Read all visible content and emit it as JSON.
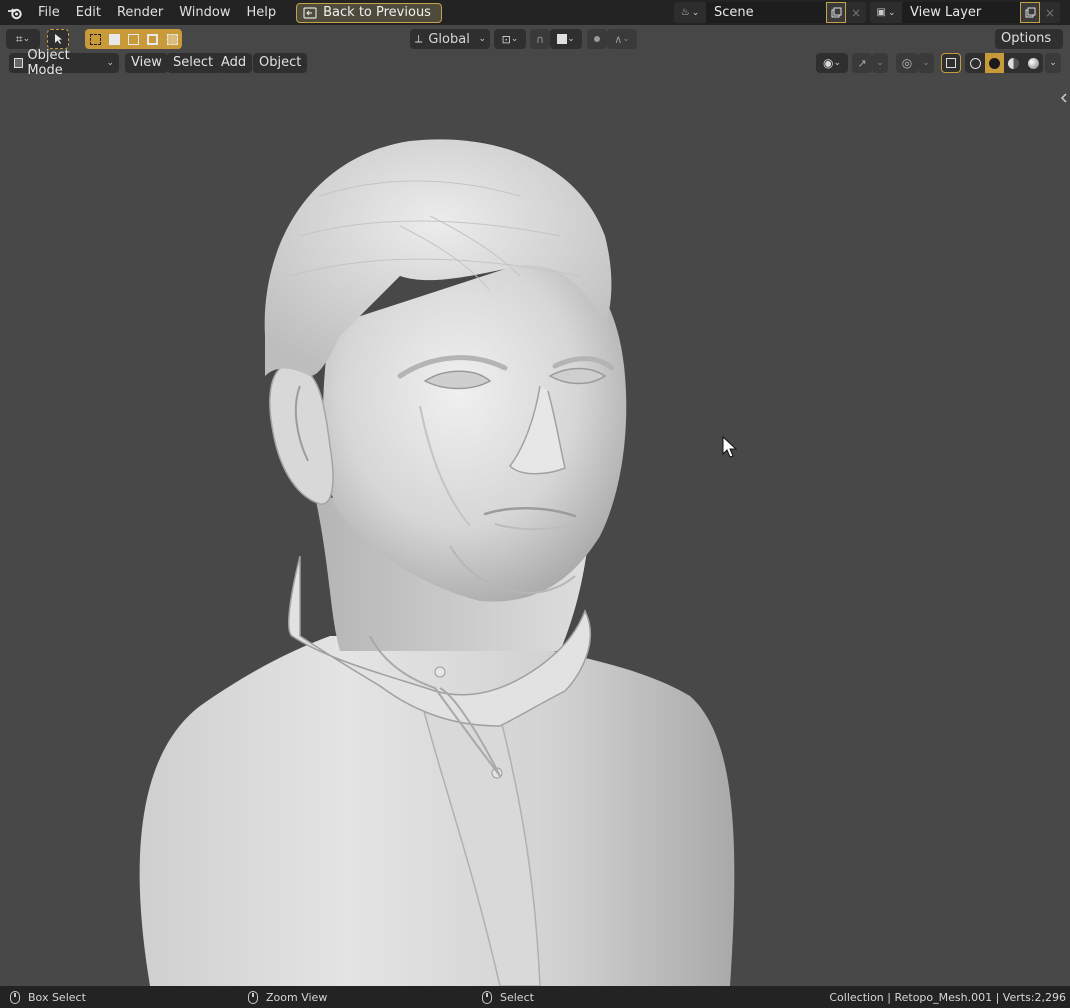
{
  "menu": {
    "items": [
      "File",
      "Edit",
      "Render",
      "Window",
      "Help"
    ],
    "back_label": "Back to Previous"
  },
  "scene": {
    "name": "Scene",
    "close": "×"
  },
  "view_layer": {
    "name": "View Layer",
    "close": "×"
  },
  "header": {
    "orientation": "Global",
    "options_label": "Options",
    "mode_label": "Object Mode",
    "view_menu": [
      "View",
      "Select",
      "Add",
      "Object"
    ]
  },
  "statusbar": {
    "left_action": "Box Select",
    "middle_action": "Zoom View",
    "right_action": "Select",
    "info": "Collection | Retopo_Mesh.001 | Verts:2,296"
  },
  "colors": {
    "accent": "#c89a3a",
    "background": "#484848",
    "topbar": "#232323"
  },
  "icons": {
    "logo": "blender-logo-icon",
    "cursor": "mouse-pointer-icon"
  }
}
